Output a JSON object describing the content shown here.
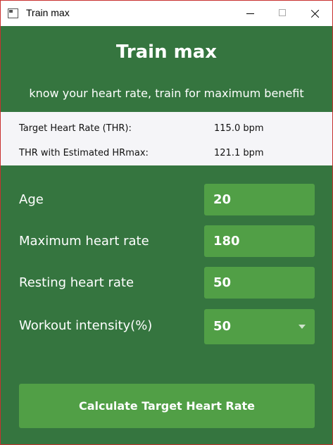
{
  "window": {
    "title": "Train max",
    "controls": [
      "minimize",
      "maximize",
      "close"
    ]
  },
  "header": {
    "title": "Train max",
    "subtitle": "know your heart rate, train for maximum benefit"
  },
  "results": [
    {
      "label": "Target Heart Rate (THR):",
      "value": "115.0 bpm"
    },
    {
      "label": "THR with Estimated HRmax:",
      "value": "121.1 bpm"
    }
  ],
  "form": {
    "age": {
      "label": "Age",
      "value": "20"
    },
    "max_hr": {
      "label": "Maximum heart rate",
      "value": "180"
    },
    "resting_hr": {
      "label": "Resting heart rate",
      "value": "50"
    },
    "intensity": {
      "label": "Workout intensity(%)",
      "value": "50"
    }
  },
  "actions": {
    "calculate_label": "Calculate Target Heart Rate"
  },
  "colors": {
    "background": "#35753f",
    "field": "#519f46",
    "results_panel": "#f5f5f8"
  }
}
